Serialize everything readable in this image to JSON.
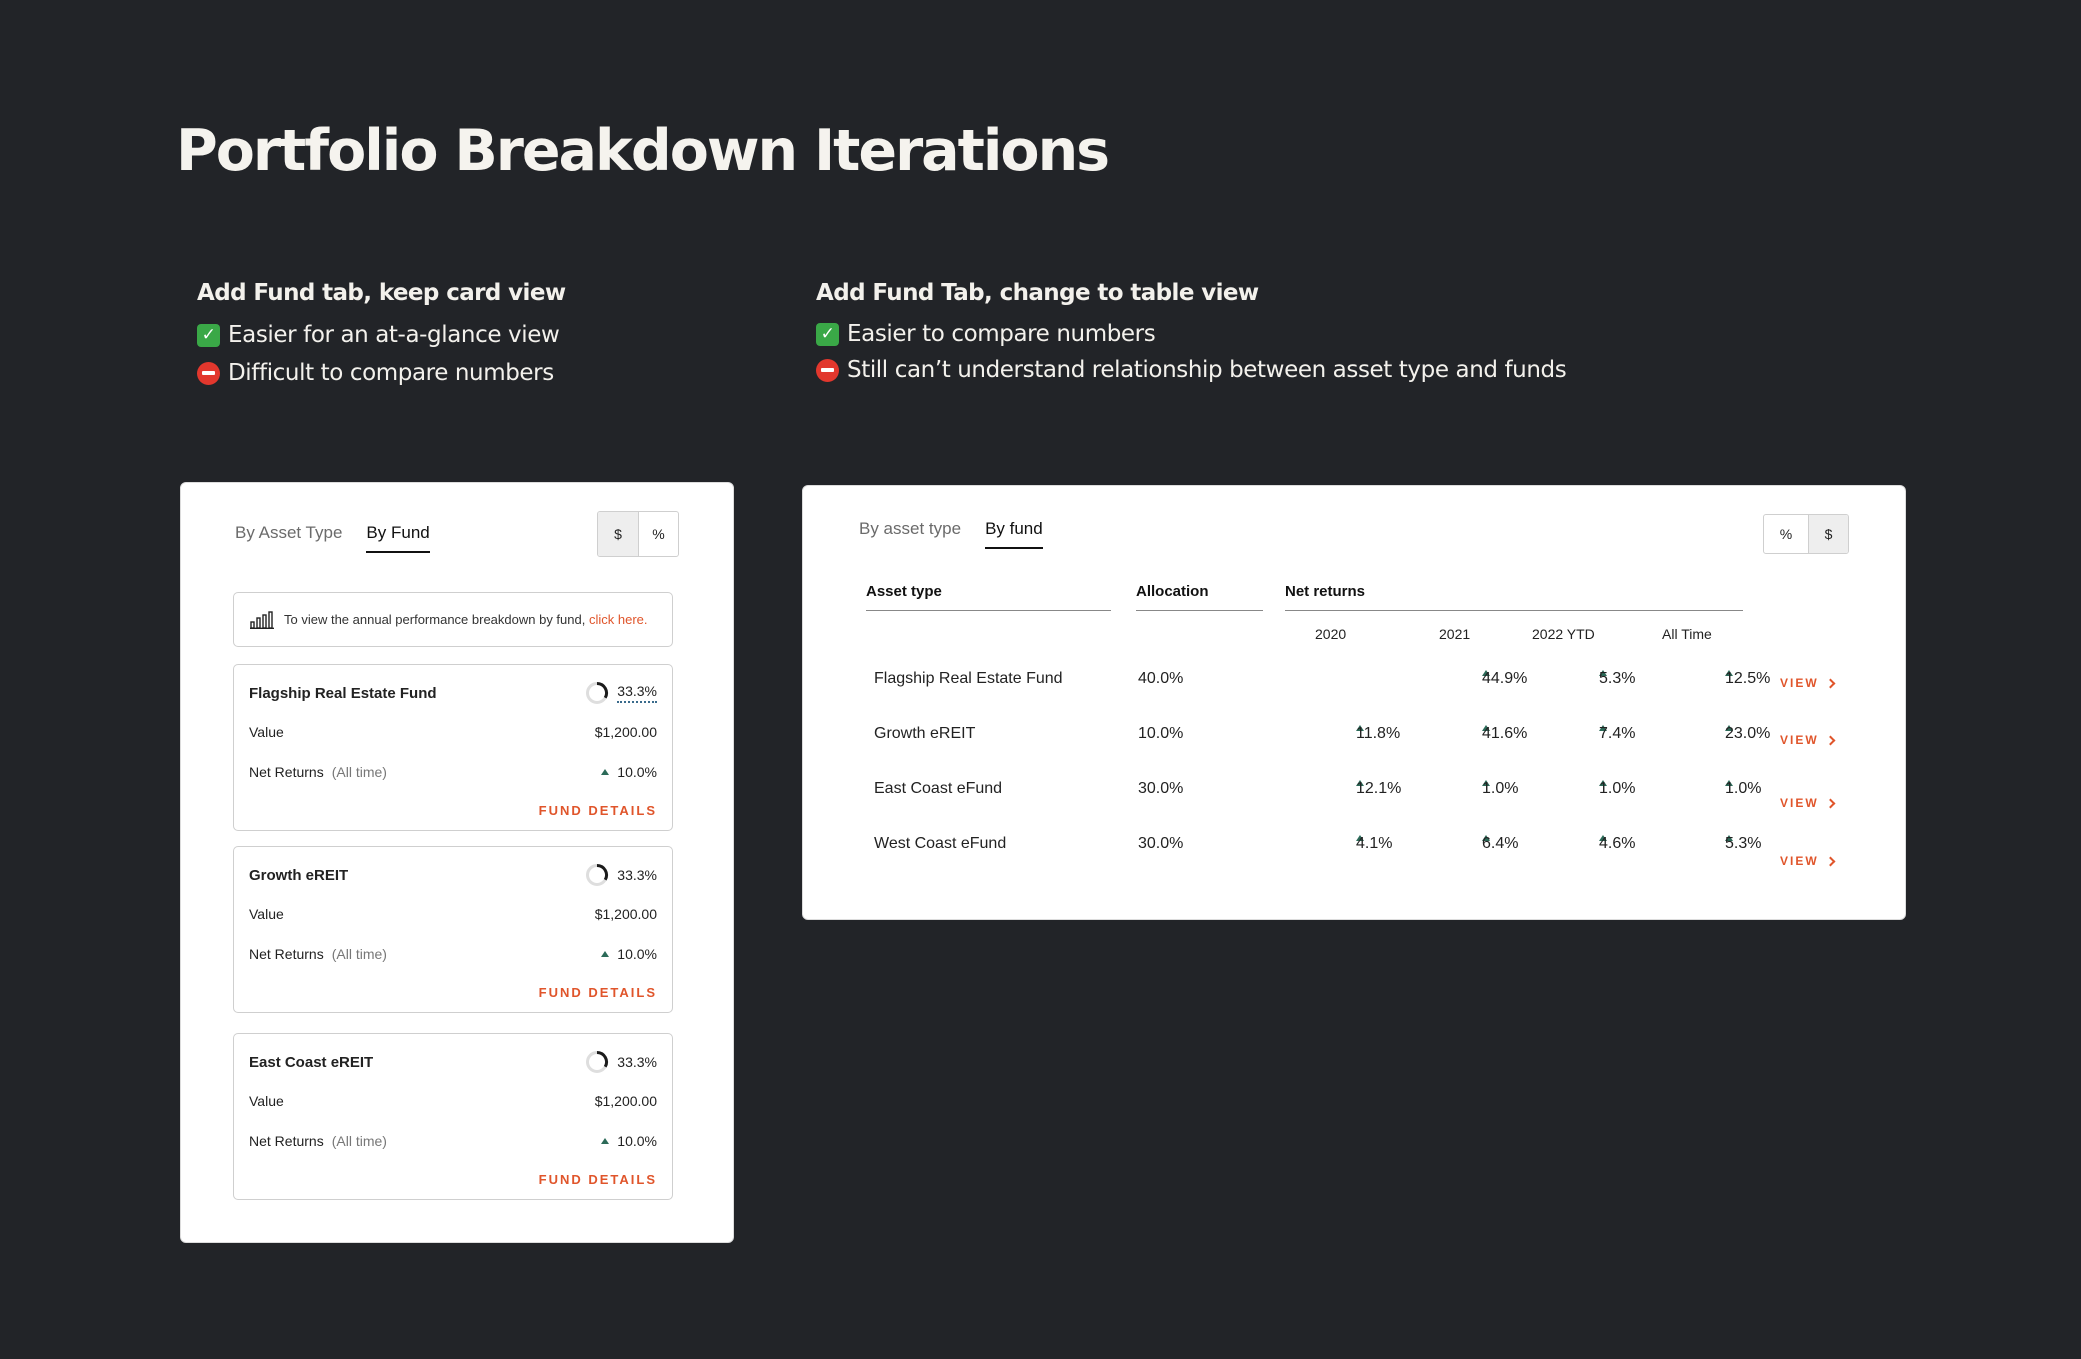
{
  "page": {
    "title": "Portfolio Breakdown Iterations"
  },
  "notes": {
    "left": {
      "heading": "Add Fund tab, keep card view",
      "pro": "Easier for an at-a-glance view",
      "con": "Difficult to compare numbers"
    },
    "right": {
      "heading": "Add Fund Tab, change to table view",
      "pro": "Easier to compare numbers",
      "con": "Still can’t understand relationship between asset type and funds"
    }
  },
  "card_view": {
    "tabs": [
      "By Asset Type",
      "By Fund"
    ],
    "active_tab": "By Fund",
    "toggle": [
      "$",
      "%"
    ],
    "info_text": "To view the annual performance breakdown by fund,",
    "info_link": "click here.",
    "cards": [
      {
        "name": "Flagship Real Estate Fund",
        "allocation": "33.3%",
        "value_label": "Value",
        "value": "$1,200.00",
        "returns_label": "Net Returns",
        "returns_period": "(All time)",
        "returns": "10.0%",
        "details": "FUND DETAILS"
      },
      {
        "name": "Growth eREIT",
        "allocation": "33.3%",
        "value_label": "Value",
        "value": "$1,200.00",
        "returns_label": "Net Returns",
        "returns_period": "(All time)",
        "returns": "10.0%",
        "details": "FUND DETAILS"
      },
      {
        "name": "East Coast eREIT",
        "allocation": "33.3%",
        "value_label": "Value",
        "value": "$1,200.00",
        "returns_label": "Net Returns",
        "returns_period": "(All time)",
        "returns": "10.0%",
        "details": "FUND DETAILS"
      }
    ]
  },
  "table_view": {
    "tabs": [
      "By asset type",
      "By fund"
    ],
    "active_tab": "By fund",
    "toggle": [
      "%",
      "$"
    ],
    "headers": {
      "asset": "Asset type",
      "allocation": "Allocation",
      "net_returns": "Net returns"
    },
    "years": [
      "2020",
      "2021",
      "2022 YTD",
      "All Time"
    ],
    "rows": [
      {
        "name": "Flagship Real Estate Fund",
        "allocation": "40.0%",
        "y2020": "",
        "y2021": "44.9%",
        "y2022": "5.3%",
        "all": "12.5%",
        "view": "VIEW"
      },
      {
        "name": "Growth eREIT",
        "allocation": "10.0%",
        "y2020": "11.8%",
        "y2021": "41.6%",
        "y2022": "7.4%",
        "all": "23.0%",
        "view": "VIEW"
      },
      {
        "name": "East Coast eFund",
        "allocation": "30.0%",
        "y2020": "12.1%",
        "y2021": "1.0%",
        "y2022": "1.0%",
        "all": "1.0%",
        "view": "VIEW"
      },
      {
        "name": "West Coast eFund",
        "allocation": "30.0%",
        "y2020": "4.1%",
        "y2021": "6.4%",
        "y2022": "4.6%",
        "all": "5.3%",
        "view": "VIEW"
      }
    ]
  },
  "colors": {
    "background": "#222428",
    "accent": "#e0552b",
    "positive": "#2b6a58"
  }
}
